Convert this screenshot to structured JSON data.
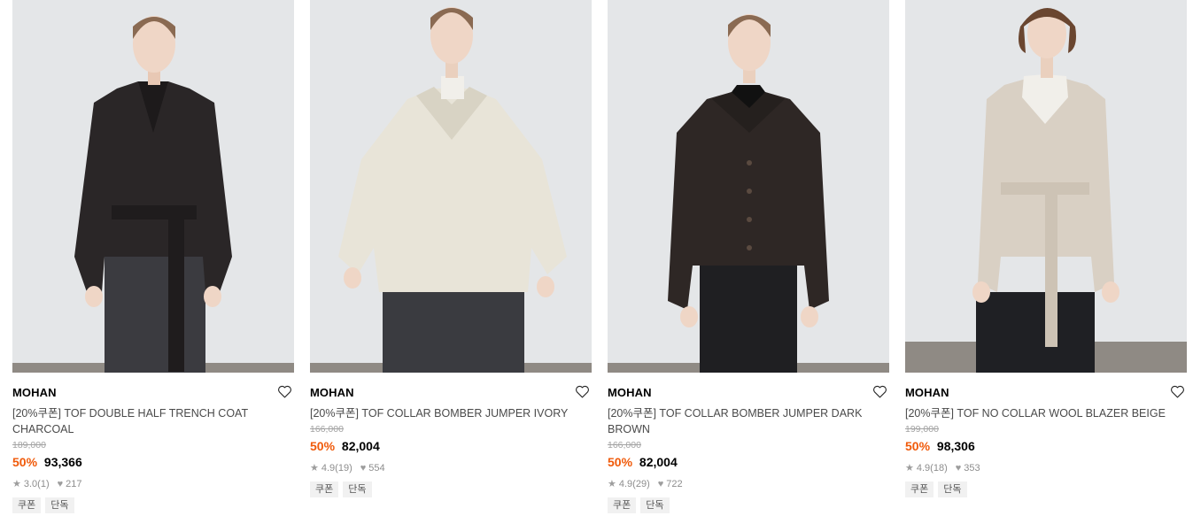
{
  "products": [
    {
      "brand": "MOHAN",
      "name": "[20%쿠폰] TOF DOUBLE HALF TRENCH COAT CHARCOAL",
      "original_price": "189,000",
      "discount": "50%",
      "price": "93,366",
      "rating": "3.0",
      "reviews": "(1)",
      "likes": "217",
      "tags": [
        "쿠폰",
        "단독"
      ],
      "garment_color": "#2a2627"
    },
    {
      "brand": "MOHAN",
      "name": "[20%쿠폰] TOF COLLAR BOMBER JUMPER IVORY",
      "original_price": "166,000",
      "discount": "50%",
      "price": "82,004",
      "rating": "4.9",
      "reviews": "(19)",
      "likes": "554",
      "tags": [
        "쿠폰",
        "단독"
      ],
      "garment_color": "#e8e4d8"
    },
    {
      "brand": "MOHAN",
      "name": "[20%쿠폰] TOF COLLAR BOMBER JUMPER DARK BROWN",
      "original_price": "166,000",
      "discount": "50%",
      "price": "82,004",
      "rating": "4.9",
      "reviews": "(29)",
      "likes": "722",
      "tags": [
        "쿠폰",
        "단독"
      ],
      "garment_color": "#2e2725"
    },
    {
      "brand": "MOHAN",
      "name": "[20%쿠폰] TOF NO COLLAR WOOL BLAZER BEIGE",
      "original_price": "199,000",
      "discount": "50%",
      "price": "98,306",
      "rating": "4.9",
      "reviews": "(18)",
      "likes": "353",
      "tags": [
        "쿠폰",
        "단독"
      ],
      "garment_color": "#d9d0c4"
    }
  ],
  "colors": {
    "discount": "#f05a0a",
    "photo_bg": "#e3e5e7"
  },
  "icons": {
    "wishlist": "heart-outline-icon",
    "rating": "star-icon",
    "likes": "heart-filled-icon"
  }
}
